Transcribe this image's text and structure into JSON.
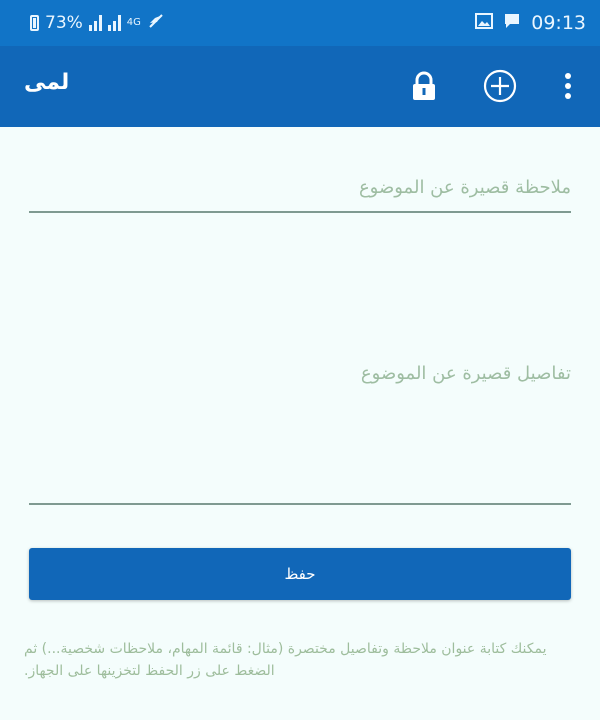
{
  "status_bar": {
    "time": "09:13",
    "battery_percent": "73%",
    "network_type": "4G"
  },
  "toolbar": {
    "title": "لمى"
  },
  "form": {
    "title_placeholder": "ملاحظة قصيرة عن الموضوع",
    "body_placeholder": "تفاصيل قصيرة عن الموضوع",
    "save_label": "حفظ"
  },
  "hint": {
    "text": "يمكنك كتابة عنوان ملاحظة وتفاصيل مختصرة (مثال: قائمة المهام، ملاحظات شخصية...) ثم الضغط على زر الحفظ لتخزينها على الجهاز."
  },
  "colors": {
    "status_bar": "#1174c7",
    "toolbar": "#1167b8",
    "background": "#f4fdfc",
    "placeholder": "#9ebda2"
  }
}
